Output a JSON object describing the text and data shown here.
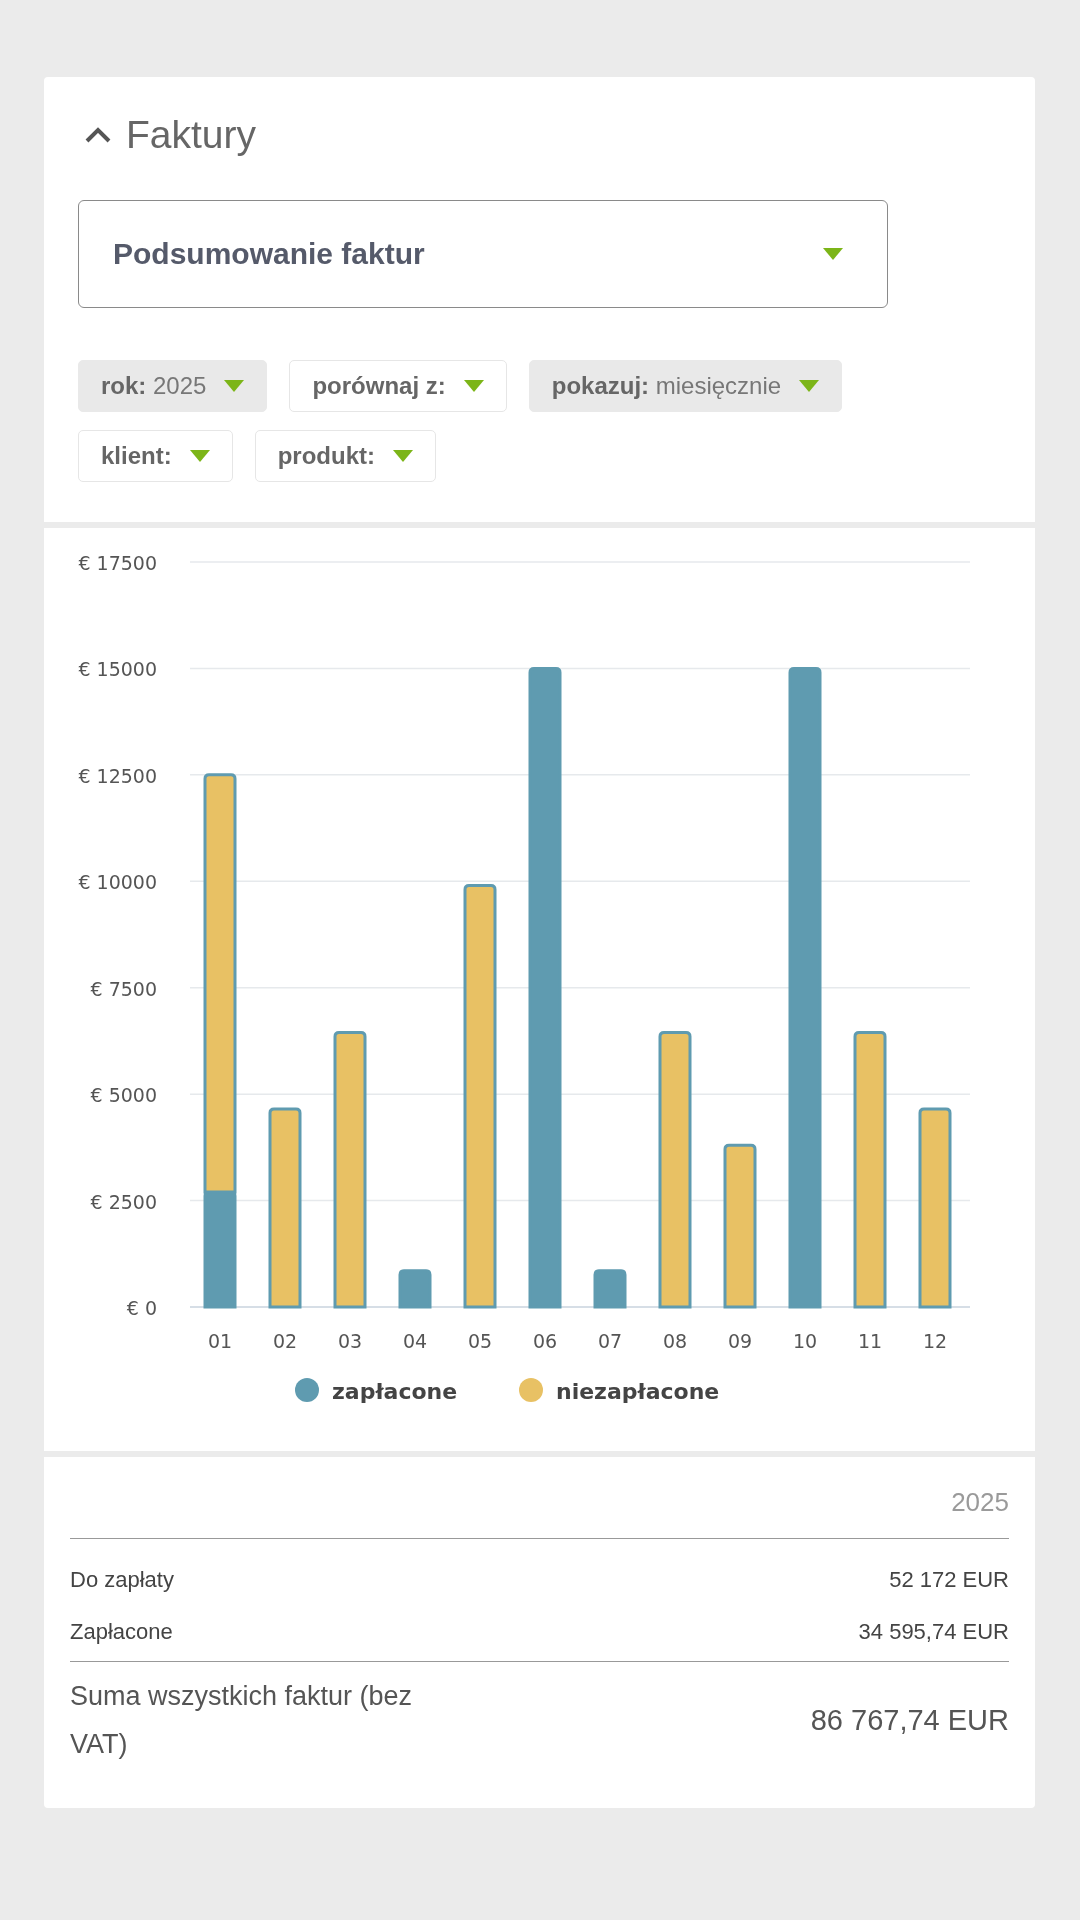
{
  "panel": {
    "title": "Faktury",
    "expanded": true
  },
  "report_select": {
    "value": "Podsumowanie faktur"
  },
  "filters": [
    {
      "label": "rok:",
      "value": "2025",
      "selected": true
    },
    {
      "label": "porównaj z:",
      "selected": false
    },
    {
      "label": "pokazuj:",
      "value": "miesięcznie",
      "selected": true
    },
    {
      "label": "klient:",
      "selected": false
    },
    {
      "label": "produkt:",
      "selected": false
    }
  ],
  "chart": {
    "chart_data": {
      "type": "bar",
      "stacked": true,
      "categories": [
        "01",
        "02",
        "03",
        "04",
        "05",
        "06",
        "07",
        "08",
        "09",
        "10",
        "11",
        "12"
      ],
      "yticks": [
        {
          "value": 0,
          "label": "€ 0"
        },
        {
          "value": 2500,
          "label": "€ 2500"
        },
        {
          "value": 5000,
          "label": "€ 5000"
        },
        {
          "value": 7500,
          "label": "€ 7500"
        },
        {
          "value": 10000,
          "label": "€ 10000"
        },
        {
          "value": 12500,
          "label": "€ 12500"
        },
        {
          "value": 15000,
          "label": "€ 15000"
        },
        {
          "value": 17500,
          "label": "€ 17500"
        }
      ],
      "ylim": [
        0,
        17500
      ],
      "grid": true,
      "legend": true,
      "series": [
        {
          "name": "zapłacone",
          "color": "#5f9bb0",
          "values": [
            2700,
            0,
            0,
            850,
            0,
            15000,
            850,
            0,
            0,
            15000,
            0,
            0
          ]
        },
        {
          "name": "niezapłacone",
          "color": "#e8c164",
          "values": [
            9800,
            4650,
            6450,
            0,
            9900,
            0,
            0,
            6450,
            3800,
            0,
            6450,
            4650
          ]
        }
      ]
    }
  },
  "summary": {
    "year": "2025",
    "rows": [
      {
        "label": "Do zapłaty",
        "value": "52 172 EUR"
      },
      {
        "label": "Zapłacone",
        "value": "34 595,74 EUR"
      }
    ],
    "total": {
      "label": "Suma wszystkich faktur (bez VAT)",
      "value": "86 767,74 EUR"
    }
  }
}
